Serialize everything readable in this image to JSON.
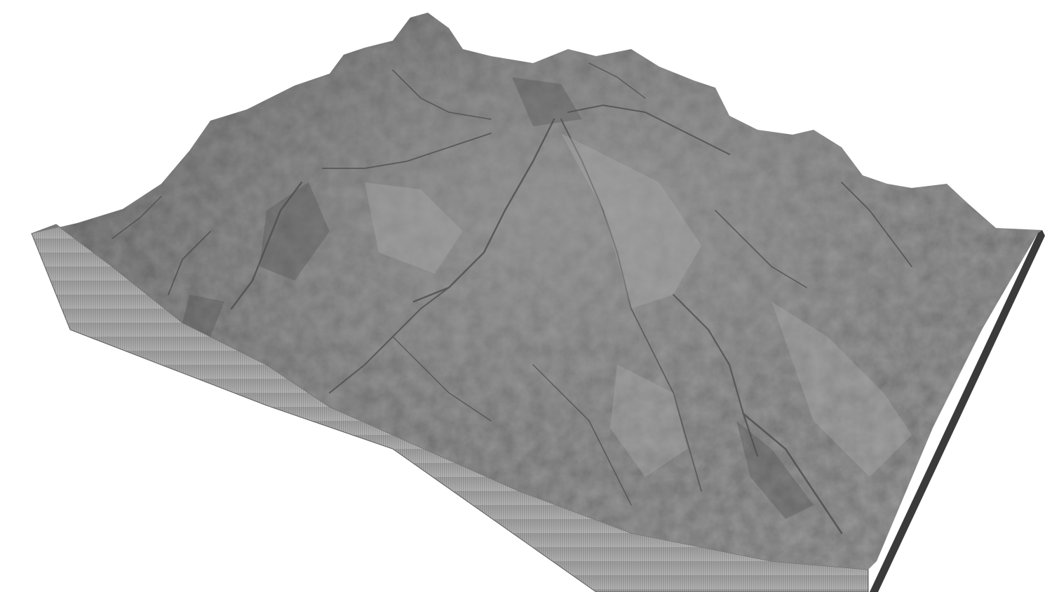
{
  "scene": {
    "subject": "terrain-model",
    "background_color": "#ffffff",
    "surface_color": "#8f8f8f",
    "surface_highlight": "#a9a9a9",
    "surface_shadow": "#4f4f4f",
    "side_wall_color": "#9a9a9a",
    "side_wall_dark": "#6a6a6a",
    "right_edge_color": "#3a3a3a"
  }
}
